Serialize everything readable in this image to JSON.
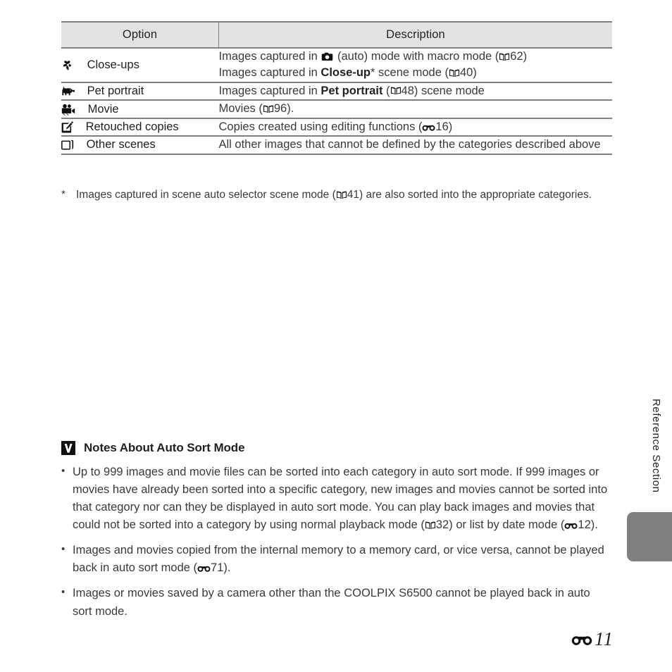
{
  "table": {
    "headers": {
      "option": "Option",
      "description": "Description"
    },
    "rows": [
      {
        "icon": "flower-macro-icon",
        "label": "Close-ups",
        "lines": [
          {
            "pre": "Images captured in ",
            "inline_icon": "camera-icon",
            "mid": " (auto) mode with macro mode (",
            "ref_icon": "book-page-icon",
            "ref": "62",
            "post": ")"
          },
          {
            "pre": "Images captured in ",
            "bold": "Close-up",
            "sup": "*",
            "mid": " scene mode (",
            "ref_icon": "book-page-icon",
            "ref": "40",
            "post": ")"
          }
        ]
      },
      {
        "icon": "pet-portrait-icon",
        "label": "Pet portrait",
        "lines": [
          {
            "pre": "Images captured in ",
            "bold": "Pet portrait",
            "mid": " (",
            "ref_icon": "book-page-icon",
            "ref": "48",
            "post": ") scene mode"
          }
        ]
      },
      {
        "icon": "movie-camera-icon",
        "label": "Movie",
        "lines": [
          {
            "pre": "Movies (",
            "ref_icon": "book-page-icon",
            "ref": "96",
            "post": ")."
          }
        ]
      },
      {
        "icon": "retouch-pen-icon",
        "label": "Retouched copies",
        "lines": [
          {
            "pre": "Copies created using editing functions (",
            "ref_icon": "e-reference-icon",
            "ref": "16",
            "post": ")"
          }
        ]
      },
      {
        "icon": "other-scenes-icon",
        "label": "Other scenes",
        "lines": [
          {
            "pre": "All other images that cannot be defined by the categories described above"
          }
        ]
      }
    ]
  },
  "footnote": {
    "marker": "*",
    "pre": "Images captured in scene auto selector scene mode (",
    "ref_icon": "book-page-icon",
    "ref": "41",
    "post": ") are also sorted into the appropriate categories."
  },
  "notes": {
    "icon": "caution-v-icon",
    "title": "Notes About Auto Sort Mode",
    "bullet_marker": "•",
    "items": [
      {
        "pre": "Up to 999 images and movie files can be sorted into each category in auto sort mode. If 999 images or movies have already been sorted into a specific category, new images and movies cannot be sorted into that category nor can they be displayed in auto sort mode. You can play back images and movies that could not be sorted into a category by using normal playback mode (",
        "ref_icon": "book-page-icon",
        "ref": "32",
        "mid": ") or list by date mode (",
        "ref_icon2": "e-reference-icon",
        "ref2": "12",
        "post": ")."
      },
      {
        "pre": "Images and movies copied from the internal memory to a memory card, or vice versa, cannot be played back in auto sort mode (",
        "ref_icon": "e-reference-icon",
        "ref": "71",
        "post": ")."
      },
      {
        "pre": "Images or movies saved by a camera other than the COOLPIX S6500 cannot be played back in auto sort mode."
      }
    ]
  },
  "sidebar": {
    "label": "Reference Section",
    "tab_color": "#808080"
  },
  "footer": {
    "icon": "e-reference-icon",
    "page": "11"
  },
  "colors": {
    "header_fill": "#e3e3e3",
    "rule": "#808080",
    "text": "#231f20",
    "body_text": "#3a3a3a"
  }
}
